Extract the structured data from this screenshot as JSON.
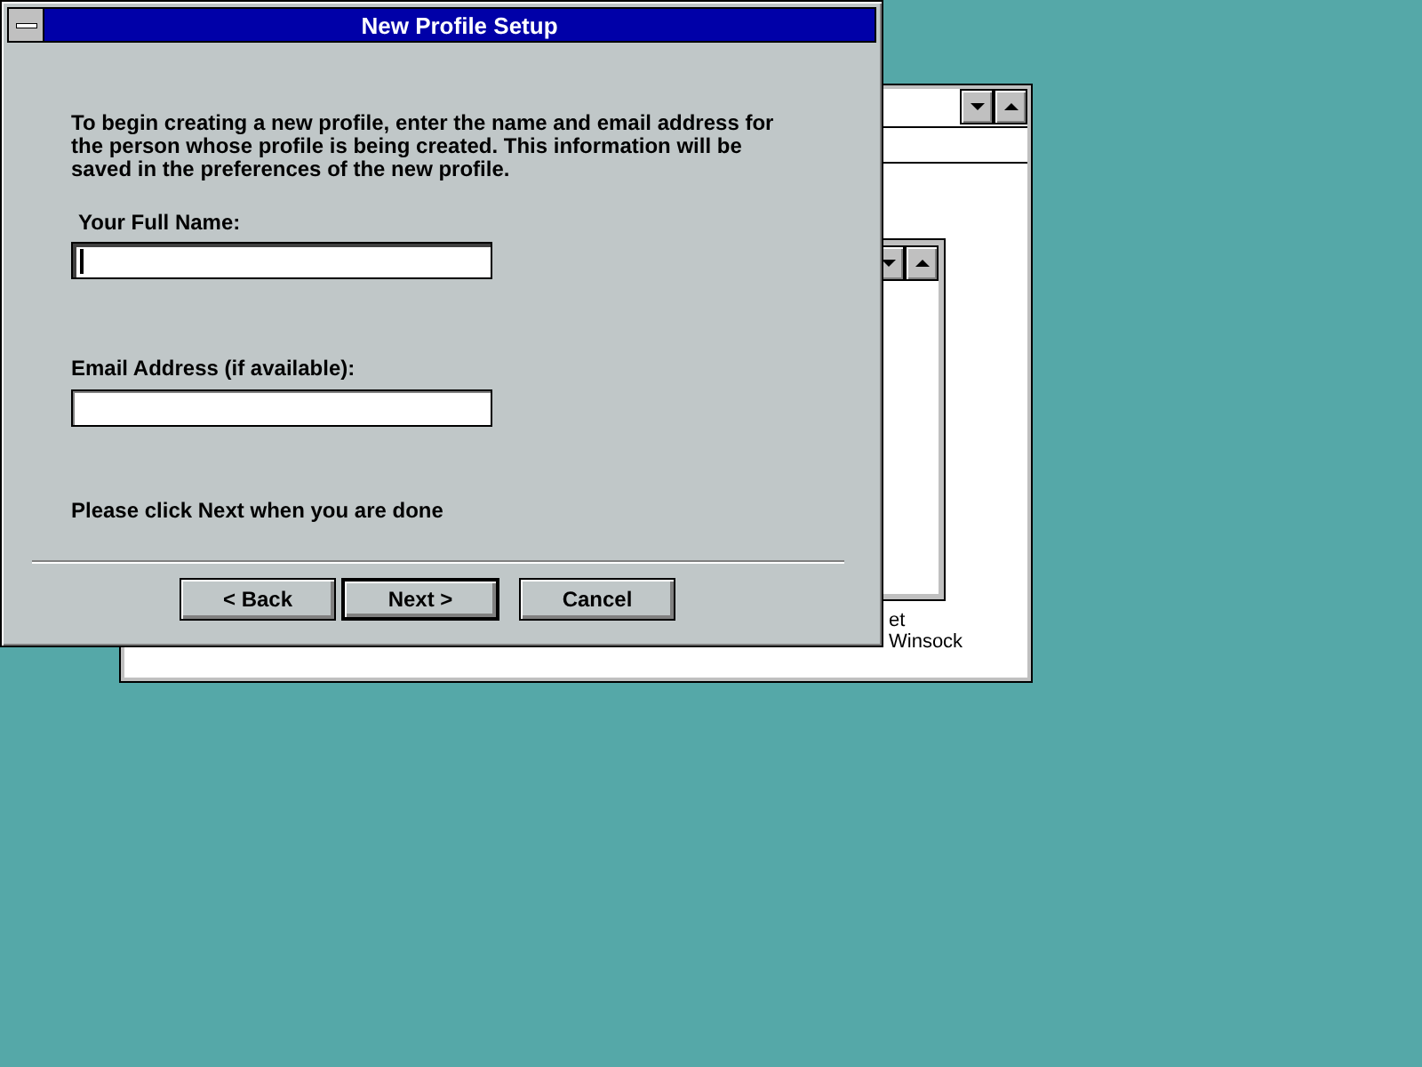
{
  "background_window": {
    "items": [
      "et",
      "Winsock"
    ]
  },
  "dialog": {
    "title": "New Profile Setup",
    "intro": "To begin creating a new profile, enter the name and email address for the person whose profile is being created.  This information will be saved in the preferences of the new profile.",
    "fields": [
      {
        "label": "Your Full Name:",
        "focused": true
      },
      {
        "label": "Email Address (if available):",
        "focused": false
      }
    ],
    "note": "Please click Next when you are done",
    "buttons": [
      {
        "label": "< Back",
        "default": false
      },
      {
        "label": "Next >",
        "default": true
      },
      {
        "label": "Cancel",
        "default": false
      }
    ]
  }
}
